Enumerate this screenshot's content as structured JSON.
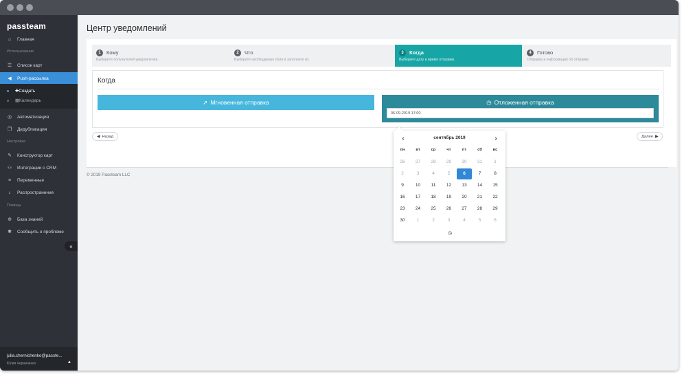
{
  "app": {
    "logo": "passteam"
  },
  "sidebar": {
    "items": [
      {
        "label": "Главная",
        "icon": "home-icon"
      },
      {
        "section": "Использование"
      },
      {
        "label": "Список карт",
        "icon": "list-icon"
      },
      {
        "label": "Push-рассылка",
        "icon": "megaphone-icon",
        "active": true
      },
      {
        "label": "Автоматизация",
        "icon": "automation-icon"
      },
      {
        "label": "Дедубликация",
        "icon": "copy-icon"
      },
      {
        "section": "Настройка"
      },
      {
        "label": "Конструктор карт",
        "icon": "brush-icon"
      },
      {
        "label": "Интеграции с CRM",
        "icon": "sitemap-icon"
      },
      {
        "label": "Переменные",
        "icon": "variables-icon"
      },
      {
        "label": "Распространение",
        "icon": "bell-icon"
      },
      {
        "section": "Помощь"
      },
      {
        "label": "База знаний",
        "icon": "lifebuoy-icon"
      },
      {
        "label": "Сообщить о проблеме",
        "icon": "bug-icon"
      }
    ],
    "subitems": [
      {
        "label": "Создать",
        "prefix": "✚",
        "active": true
      },
      {
        "label": "Календарь",
        "prefix": "▦"
      }
    ],
    "collapse_icon": "«",
    "user": {
      "email": "julia.chernichenko@passte...",
      "name": "Юлия Черниченко"
    }
  },
  "page": {
    "title": "Центр уведомлений"
  },
  "steps": [
    {
      "num": "1",
      "title": "Кому",
      "desc": "Выберите получателей уведомления."
    },
    {
      "num": "2",
      "title": "Что",
      "desc": "Выберите необходимые поля и заполните их."
    },
    {
      "num": "3",
      "title": "Когда",
      "desc": "Выберите дату и время отправки.",
      "active": true
    },
    {
      "num": "4",
      "title": "Готово",
      "desc": "Отправка и информация об отправке."
    }
  ],
  "when": {
    "title": "Когда",
    "instant_label": "Мгновенная отправка",
    "deferred_label": "Отложенная отправка",
    "date_value": "06-09-2019 17:00"
  },
  "nav_buttons": {
    "back": "Назад",
    "next": "Далее"
  },
  "footer": {
    "copyright": "© 2019 Passteam LLC"
  },
  "calendar": {
    "month": "сентябрь 2019",
    "weekdays": [
      "пн",
      "вт",
      "ср",
      "чт",
      "пт",
      "сб",
      "вс"
    ],
    "selected": "6",
    "weeks": [
      [
        "26",
        "27",
        "28",
        "29",
        "30",
        "31",
        "1"
      ],
      [
        "2",
        "3",
        "4",
        "5",
        "6",
        "7",
        "8"
      ],
      [
        "9",
        "10",
        "11",
        "12",
        "13",
        "14",
        "15"
      ],
      [
        "16",
        "17",
        "18",
        "19",
        "20",
        "21",
        "22"
      ],
      [
        "23",
        "24",
        "25",
        "26",
        "27",
        "28",
        "29"
      ],
      [
        "30",
        "1",
        "2",
        "3",
        "4",
        "5",
        "6"
      ]
    ],
    "muted": [
      [
        0,
        0
      ],
      [
        0,
        1
      ],
      [
        0,
        2
      ],
      [
        0,
        3
      ],
      [
        0,
        4
      ],
      [
        0,
        5
      ],
      [
        0,
        6
      ],
      [
        1,
        0
      ],
      [
        1,
        1
      ],
      [
        1,
        2
      ],
      [
        1,
        3
      ],
      [
        5,
        1
      ],
      [
        5,
        2
      ],
      [
        5,
        3
      ],
      [
        5,
        4
      ],
      [
        5,
        5
      ],
      [
        5,
        6
      ]
    ]
  },
  "colors": {
    "accent": "#17a5a5",
    "primary": "#3a8fd9",
    "instant": "#46b6dd",
    "deferred": "#2c8a9a",
    "selected_day": "#2f87d6"
  }
}
